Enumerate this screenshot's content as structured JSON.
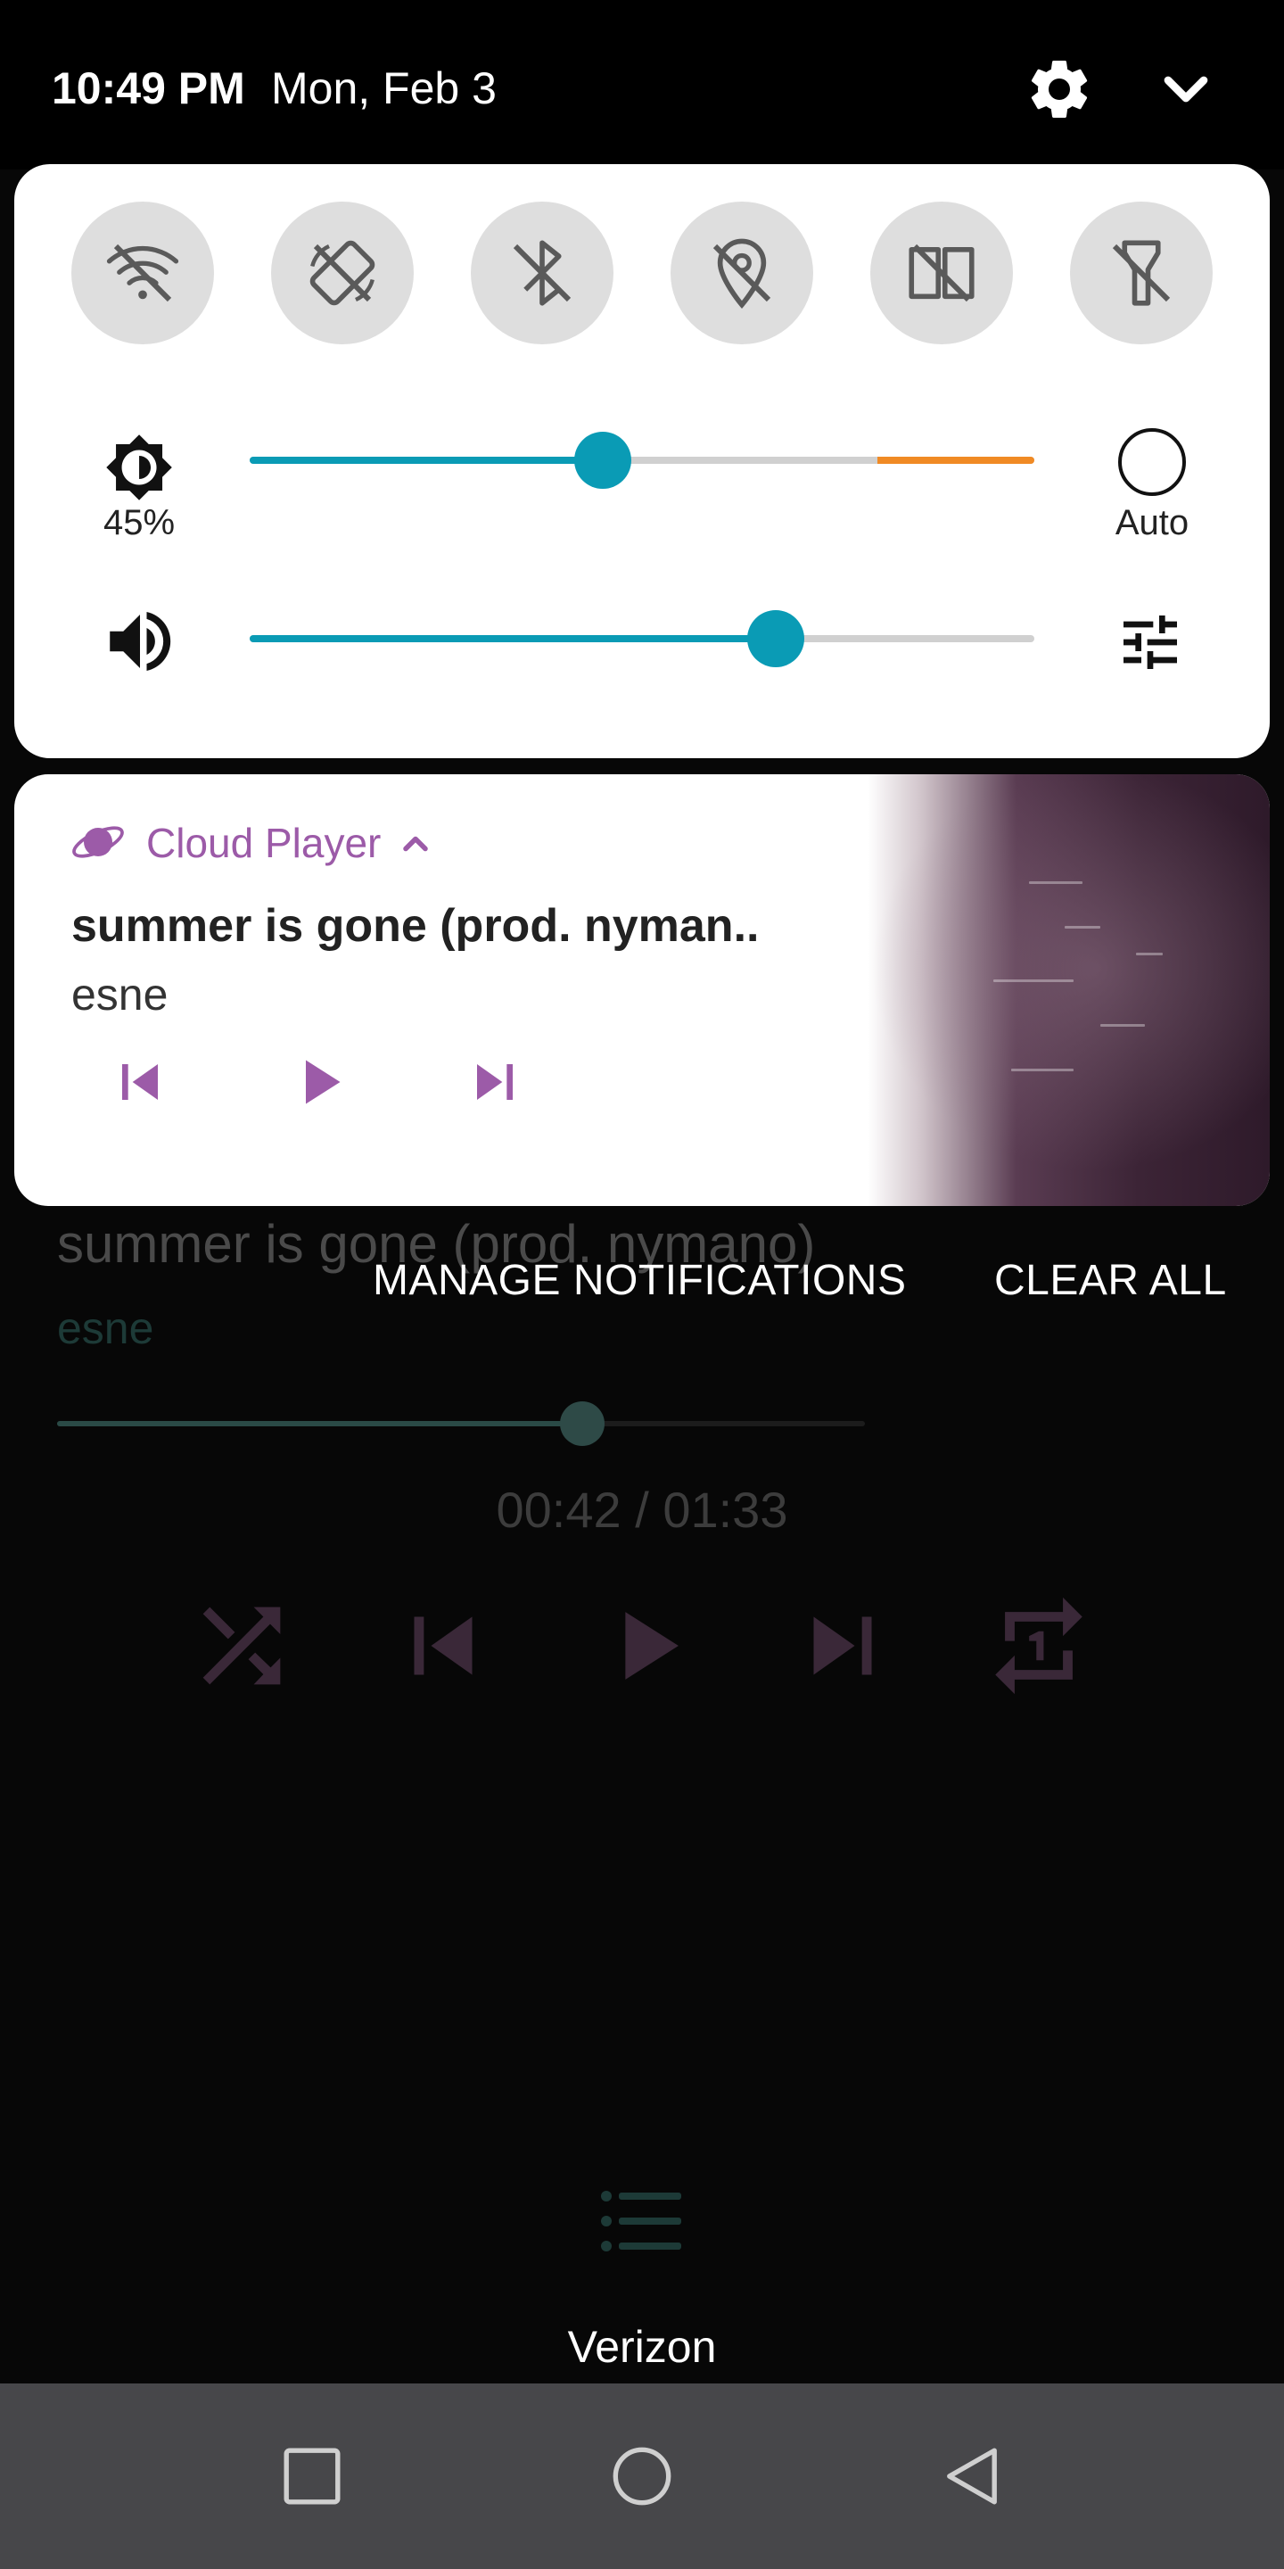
{
  "status_bar": {
    "time": "10:49 PM",
    "date": "Mon, Feb 3",
    "icons": [
      "settings-icon",
      "chevron-down-icon"
    ]
  },
  "quick_settings": {
    "tiles": [
      {
        "name": "wifi-off-icon",
        "state": "off"
      },
      {
        "name": "auto-rotate-off-icon",
        "state": "off"
      },
      {
        "name": "bluetooth-off-icon",
        "state": "off"
      },
      {
        "name": "location-off-icon",
        "state": "off"
      },
      {
        "name": "reading-mode-off-icon",
        "state": "off"
      },
      {
        "name": "flashlight-off-icon",
        "state": "off"
      }
    ],
    "brightness": {
      "percent_label": "45%",
      "level": 0.45,
      "auto_label": "Auto",
      "auto_enabled": false
    },
    "volume": {
      "level": 0.67
    }
  },
  "notification": {
    "app_name": "Cloud Player",
    "title": "summer is gone (prod. nyman..",
    "artist": "esne",
    "controls": [
      "previous",
      "play",
      "next"
    ],
    "accent": "#9c5ba8"
  },
  "notification_actions": {
    "manage_label": "MANAGE NOTIFICATIONS",
    "clear_label": "CLEAR ALL"
  },
  "background_player": {
    "title": "summer is gone (prod. nymano)",
    "artist": "esne",
    "progress": 0.65,
    "time": "00:42 / 01:33",
    "carrier": "Verizon"
  },
  "colors": {
    "accent_teal": "#0a9bb5",
    "warning_orange": "#f08a24",
    "notification_purple": "#9c5ba8"
  }
}
